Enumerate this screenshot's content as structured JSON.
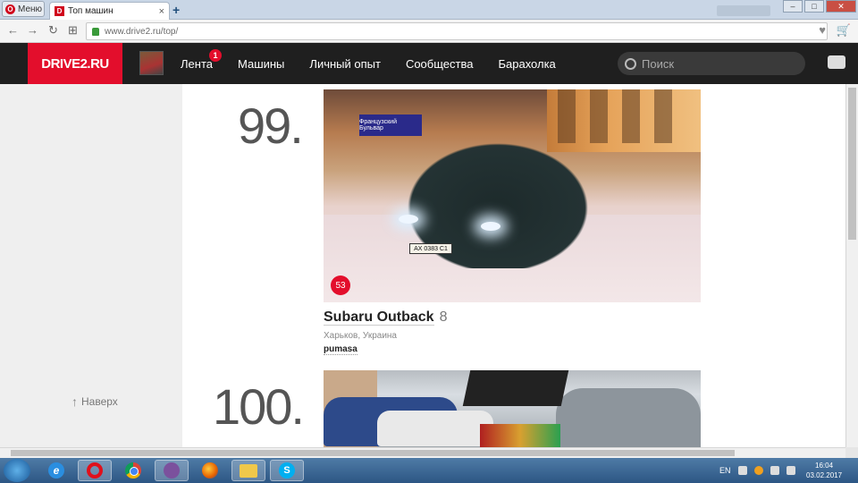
{
  "browser": {
    "menu_label": "Меню",
    "tab_title": "Топ машин",
    "tab_close": "×",
    "new_tab": "+",
    "url": "www.drive2.ru/top/",
    "window_controls": [
      "–",
      "□",
      "✕"
    ],
    "nav_back": "←",
    "nav_forward": "→",
    "nav_reload": "↻",
    "nav_apps": "⊞",
    "heart_glyph": "♥",
    "cart_glyph": "🛒"
  },
  "site": {
    "logo": "DRIVE2.RU",
    "nav": [
      {
        "label": "Лента",
        "badge": "1"
      },
      {
        "label": "Машины"
      },
      {
        "label": "Личный опыт"
      },
      {
        "label": "Сообщества"
      },
      {
        "label": "Барахолка"
      }
    ],
    "search_placeholder": "Поиск"
  },
  "sidebar": {
    "up_arrow": "↑",
    "up_label": "Наверх"
  },
  "entries": [
    {
      "rank": "99.",
      "likes": "53",
      "title": "Subaru Outback",
      "count": "8",
      "location": "Харьков, Украина",
      "owner": "pumasa",
      "photo_sign": "Французский Бульвар",
      "plate": "АХ 0383 С1"
    },
    {
      "rank": "100."
    }
  ],
  "taskbar": {
    "ie_glyph": "e",
    "skype_glyph": "S",
    "lang": "EN",
    "time": "16:04",
    "date": "03.02.2017"
  },
  "icons": {
    "opera": "opera-icon",
    "search": "search-icon",
    "chat": "chat-icon",
    "lock": "lock-icon",
    "heart": "heart-icon",
    "cart": "cart-icon"
  },
  "colors": {
    "brand_red": "#e30e2c",
    "header_bg": "#1f1f1f"
  }
}
